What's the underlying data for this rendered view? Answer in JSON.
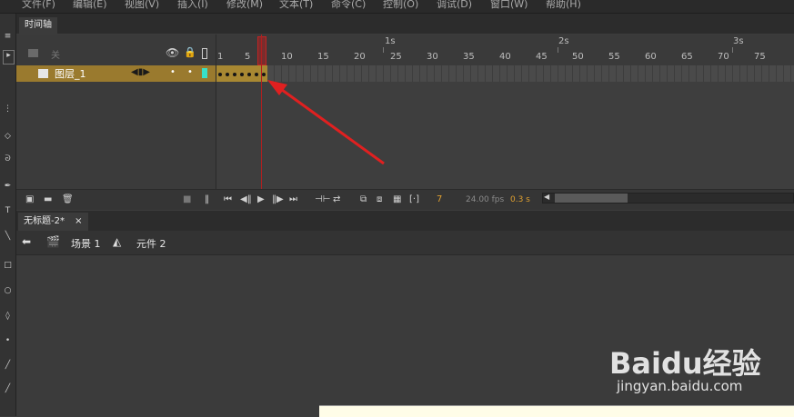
{
  "menubar": {
    "items": [
      "文件(F)",
      "编辑(E)",
      "视图(V)",
      "插入(I)",
      "修改(M)",
      "文本(T)",
      "命令(C)",
      "控制(O)",
      "调试(D)",
      "窗口(W)",
      "帮助(H)"
    ]
  },
  "timeline": {
    "panel_title": "时间轴",
    "folder_label": "关",
    "layer_name": "图层_1",
    "ruler_numbers": [
      "1",
      "5",
      "10",
      "15",
      "20",
      "25",
      "30",
      "35",
      "40",
      "45",
      "50",
      "55",
      "60",
      "65",
      "70",
      "75"
    ],
    "second_labels": [
      "1s",
      "2s",
      "3s"
    ],
    "current_frame": "7",
    "fps": "24.00 fps",
    "elapsed": "0.3 s"
  },
  "document": {
    "tab_title": "无标题-2*",
    "close": "×",
    "breadcrumb_scene": "场景 1",
    "breadcrumb_symbol": "元件 2"
  },
  "watermark": {
    "brand": "Baidu经验",
    "url": "jingyan.baidu.com"
  },
  "colors": {
    "layer_highlight": "#9a7a2e",
    "playhead": "#b01f1f",
    "annotation_arrow": "#e02020",
    "stage_bg": "#3b3b3b"
  }
}
